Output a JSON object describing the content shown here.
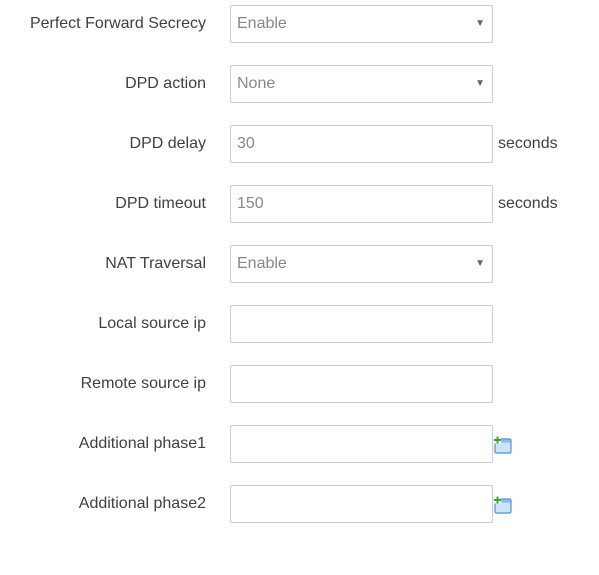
{
  "fields": {
    "pfs": {
      "label": "Perfect Forward Secrecy",
      "value": "Enable"
    },
    "dpd_action": {
      "label": "DPD action",
      "value": "None"
    },
    "dpd_delay": {
      "label": "DPD delay",
      "value": "30",
      "unit": "seconds"
    },
    "dpd_timeout": {
      "label": "DPD timeout",
      "value": "150",
      "unit": "seconds"
    },
    "nat_traversal": {
      "label": "NAT Traversal",
      "value": "Enable"
    },
    "local_source_ip": {
      "label": "Local source ip",
      "value": ""
    },
    "remote_source_ip": {
      "label": "Remote source ip",
      "value": ""
    },
    "additional_phase1": {
      "label": "Additional phase1",
      "value": "",
      "icon": "add-entry-icon"
    },
    "additional_phase2": {
      "label": "Additional phase2",
      "value": "",
      "icon": "add-entry-icon"
    }
  },
  "colors": {
    "label_text": "#404040",
    "input_text": "#888888",
    "border": "#cccccc",
    "icon_blue": "#4a90d9",
    "icon_green": "#3aa33a"
  }
}
